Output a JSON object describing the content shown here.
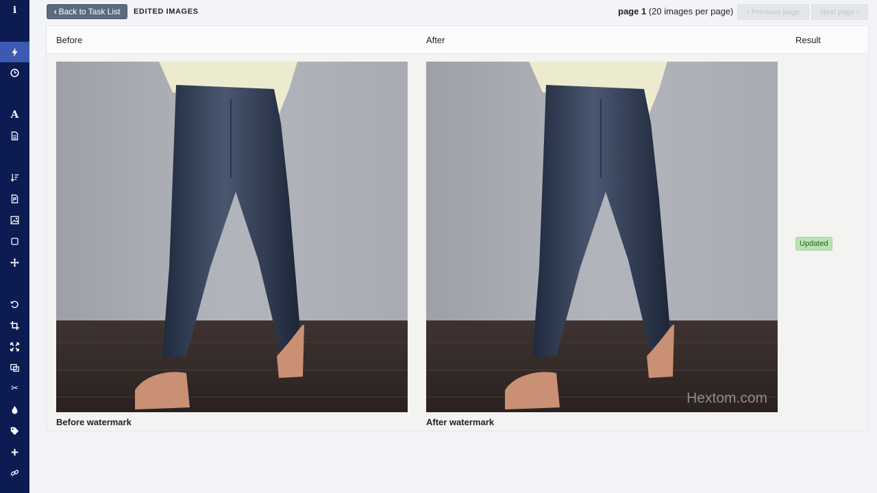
{
  "sidebar": {
    "items": [
      {
        "icon": "info-icon",
        "glyph": "i"
      },
      {
        "icon": "lightning-icon",
        "glyph": "⚡",
        "active": true
      },
      {
        "icon": "clock-icon",
        "glyph": "◷"
      },
      {
        "icon": "font-icon",
        "glyph": "A"
      },
      {
        "icon": "document-icon",
        "glyph": "▤"
      },
      {
        "icon": "sort-icon",
        "glyph": "⇣"
      },
      {
        "icon": "file-icon",
        "glyph": "▦"
      },
      {
        "icon": "image-icon",
        "glyph": "▨"
      },
      {
        "icon": "square-icon",
        "glyph": "▢"
      },
      {
        "icon": "move-icon",
        "glyph": "✥"
      },
      {
        "icon": "rotate-icon",
        "glyph": "↺"
      },
      {
        "icon": "crop-icon",
        "glyph": "⌗"
      },
      {
        "icon": "expand-icon",
        "glyph": "⤧"
      },
      {
        "icon": "resize-icon",
        "glyph": "⧉"
      },
      {
        "icon": "scissors-icon",
        "glyph": "✂"
      },
      {
        "icon": "drop-icon",
        "glyph": "●"
      },
      {
        "icon": "tag-icon",
        "glyph": "◆"
      },
      {
        "icon": "plus-icon",
        "glyph": "✚"
      },
      {
        "icon": "link-icon",
        "glyph": "∞"
      }
    ]
  },
  "topbar": {
    "back_label": "Back to Task List",
    "heading": "EDITED IMAGES",
    "page_label": "page 1",
    "per_page": "(20 images per page)",
    "prev_label": "Previous page",
    "next_label": "Next page"
  },
  "table": {
    "col_before": "Before",
    "col_after": "After",
    "col_result": "Result",
    "caption_before": "Before watermark",
    "caption_after": "After watermark",
    "watermark": "Hextom.com",
    "result_badge": "Updated"
  },
  "colors": {
    "sidebar": "#0c1b52",
    "sidebar_active": "#3d5ab3",
    "badge_bg": "#b7e4b1"
  }
}
